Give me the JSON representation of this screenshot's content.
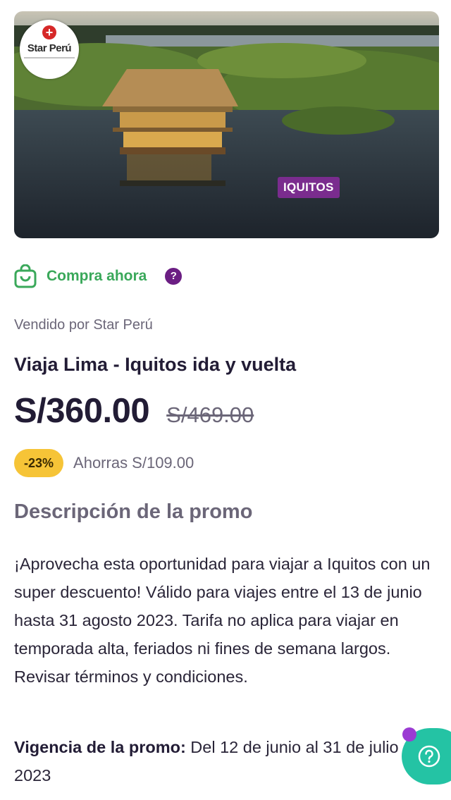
{
  "hero": {
    "brand": "Star Perú",
    "destination_badge": "IQUITOS"
  },
  "buy": {
    "label": "Compra ahora",
    "help": "?"
  },
  "seller": "Vendido por Star Perú",
  "title": "Viaja Lima - Iquitos ida y vuelta",
  "price": {
    "current": "S/360.00",
    "original": "S/469.00",
    "discount": "-23%",
    "savings": "Ahorras S/109.00"
  },
  "description": {
    "heading": "Descripción de la promo",
    "text": "¡Aprovecha esta oportunidad para viajar a Iquitos con un super descuento! Válido para viajes entre el 13 de junio hasta 31 agosto 2023. Tarifa no aplica para viajar en temporada alta, feriados ni fines de semana largos. Revisar términos y condiciones."
  },
  "validity": {
    "label": "Vigencia de la promo:",
    "value": " Del 12 de junio al 31 de julio de 2023"
  },
  "colors": {
    "accent_purple": "#7a2c8e",
    "buy_green": "#3aa85a",
    "discount_yellow": "#f6c437",
    "fab_teal": "#24c3a4"
  }
}
